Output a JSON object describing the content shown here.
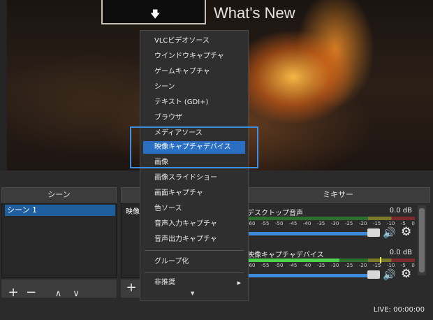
{
  "preview": {
    "arrow_glyph": "🡇",
    "title_text": "What's New"
  },
  "docks": {
    "scenes_header": "シーン",
    "mixer_header": "ミキサー",
    "scene_items": [
      "シーン 1"
    ],
    "sources_partial": "映像"
  },
  "toolbar": {
    "add": "+",
    "remove": "−",
    "up": "∧",
    "down": "∨",
    "add2": "+"
  },
  "mixer": {
    "tracks": [
      {
        "name": "デスクトップ音声",
        "db": "0.0 dB",
        "level": 0.0
      },
      {
        "name": "映像キャプチャデバイス",
        "db": "0.0 dB",
        "level": 0.55
      }
    ],
    "scale": [
      "-60",
      "-55",
      "-50",
      "-45",
      "-40",
      "-35",
      "-30",
      "-25",
      "-20",
      "-15",
      "-10",
      "-5",
      "0"
    ]
  },
  "menu": {
    "items": [
      "VLCビデオソース",
      "ウインドウキャプチャ",
      "ゲームキャプチャ",
      "シーン",
      "テキスト (GDI+)",
      "ブラウザ",
      "メディアソース",
      "映像キャプチャデバイス",
      "画像",
      "画像スライドショー",
      "画面キャプチャ",
      "色ソース",
      "音声入力キャプチャ",
      "音声出力キャプチャ"
    ],
    "selected_index": 7,
    "group": "グループ化",
    "deprecated": "非推奨"
  },
  "status": {
    "live": "LIVE: 00:00:00"
  },
  "colors": {
    "accent": "#2a6fc2",
    "highlight_border": "#3f8fe0"
  }
}
